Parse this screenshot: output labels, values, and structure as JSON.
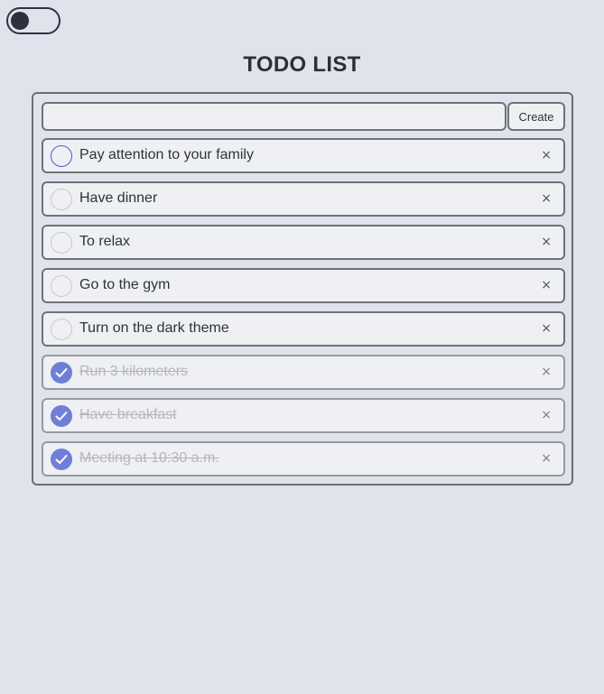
{
  "app": {
    "title": "TODO LIST"
  },
  "theme_toggle": {
    "state": "off",
    "icon": "dark-mode-toggle"
  },
  "new_todo": {
    "value": "",
    "placeholder": "",
    "create_label": "Create"
  },
  "todos": [
    {
      "text": "Pay attention to your family",
      "done": false
    },
    {
      "text": "Have dinner",
      "done": false
    },
    {
      "text": "To relax",
      "done": false
    },
    {
      "text": "Go to the gym",
      "done": false
    },
    {
      "text": "Turn on the dark theme",
      "done": false
    },
    {
      "text": "Run 3 kilometers",
      "done": true
    },
    {
      "text": "Have breakfast",
      "done": true
    },
    {
      "text": "Meeting at 10:30 a.m.",
      "done": true
    }
  ],
  "delete_glyph": "×",
  "colors": {
    "accent": "#6f7fd8",
    "background": "#dfe3ec",
    "focus_ring": "#4a5cc4"
  }
}
